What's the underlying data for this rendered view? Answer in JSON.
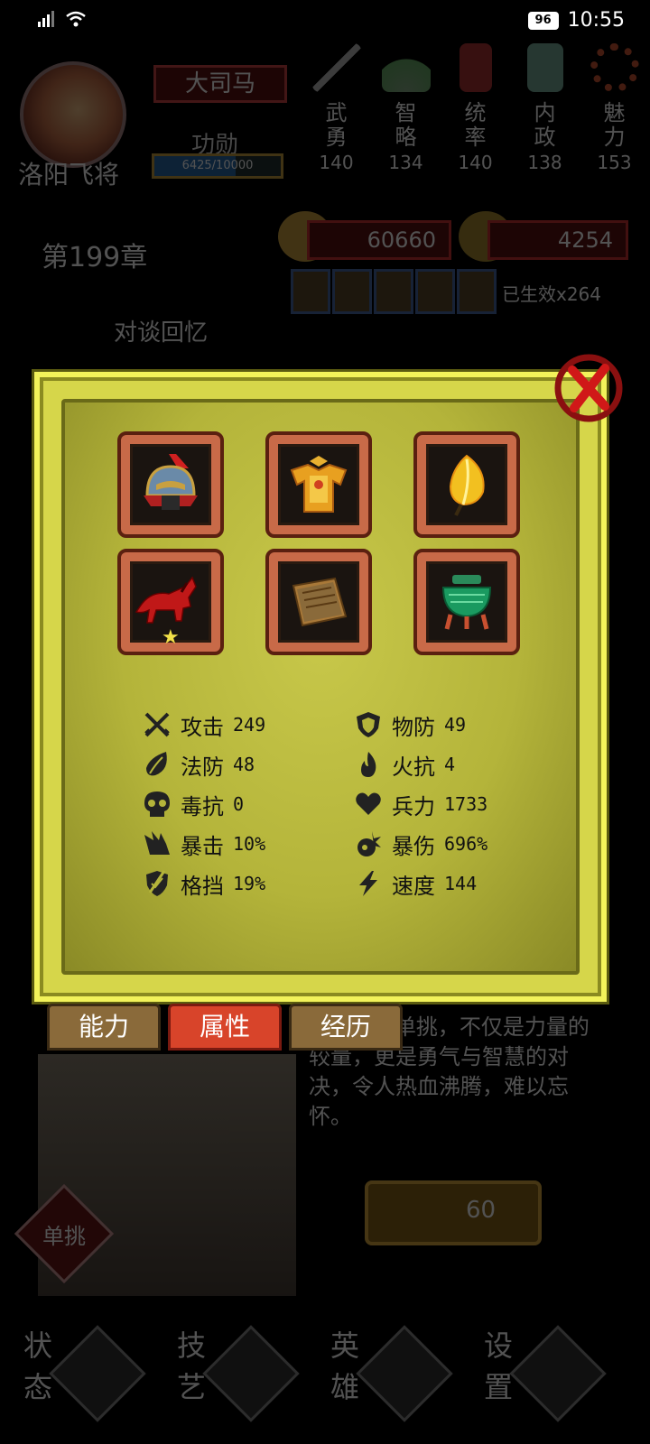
{
  "status_bar": {
    "battery": "96",
    "time": "10:55"
  },
  "hero": {
    "name": "洛阳飞将",
    "rank": "大司马",
    "merit_label": "功勋",
    "merit_value": "6425/10000",
    "merit_fraction": 0.6425
  },
  "top_stats": [
    {
      "label": "武勇",
      "value": "140",
      "icon": "halberd-icon"
    },
    {
      "label": "智略",
      "value": "134",
      "icon": "fan-icon"
    },
    {
      "label": "统率",
      "value": "140",
      "icon": "command-token-icon"
    },
    {
      "label": "内政",
      "value": "138",
      "icon": "seal-icon"
    },
    {
      "label": "魅力",
      "value": "153",
      "icon": "beads-icon"
    }
  ],
  "chapter": "第199章",
  "resources": {
    "coins": "60660",
    "grain": "4254"
  },
  "buildings_effective": "已生效x264",
  "memory_title": "对谈回忆",
  "story_text": "...创性的单挑，不仅是力量的较量，更是勇气与智慧的对决，令人热血沸腾，难以忘怀。",
  "duel_label": "单挑",
  "coin_button_value": "60",
  "bottom_nav": [
    {
      "label": "状态",
      "icon": "dragon-icon"
    },
    {
      "label": "技艺",
      "icon": "feather-icon"
    },
    {
      "label": "英雄",
      "icon": "helmet-icon"
    },
    {
      "label": "设置",
      "icon": "gear-icon"
    }
  ],
  "equipment": [
    {
      "icon": "helmet-icon",
      "starred": false
    },
    {
      "icon": "golden-armor-icon",
      "starred": false
    },
    {
      "icon": "golden-feather-icon",
      "starred": false
    },
    {
      "icon": "red-horse-icon",
      "starred": true
    },
    {
      "icon": "book-icon",
      "starred": false
    },
    {
      "icon": "jade-cauldron-icon",
      "starred": false
    }
  ],
  "attributes": [
    {
      "name": "攻击",
      "value": "249",
      "icon": "crossed-swords-icon"
    },
    {
      "name": "物防",
      "value": "49",
      "icon": "shield-icon"
    },
    {
      "name": "法防",
      "value": "48",
      "icon": "leaf-icon"
    },
    {
      "name": "火抗",
      "value": "4",
      "icon": "flame-icon"
    },
    {
      "name": "毒抗",
      "value": "0",
      "icon": "skull-icon"
    },
    {
      "name": "兵力",
      "value": "1733",
      "icon": "heart-icon"
    },
    {
      "name": "暴击",
      "value": "10%",
      "icon": "claw-icon"
    },
    {
      "name": "暴伤",
      "value": "696%",
      "icon": "burst-icon"
    },
    {
      "name": "格挡",
      "value": "19%",
      "icon": "block-shield-icon"
    },
    {
      "name": "速度",
      "value": "144",
      "icon": "lightning-icon"
    }
  ],
  "tabs": [
    {
      "label": "能力",
      "active": false
    },
    {
      "label": "属性",
      "active": true
    },
    {
      "label": "经历",
      "active": false
    }
  ],
  "colors": {
    "modal_bg": "#d6d64a",
    "tab_active": "#d8442a",
    "tab_inactive": "#8a6a3a",
    "slot_frame": "#c86a48"
  }
}
